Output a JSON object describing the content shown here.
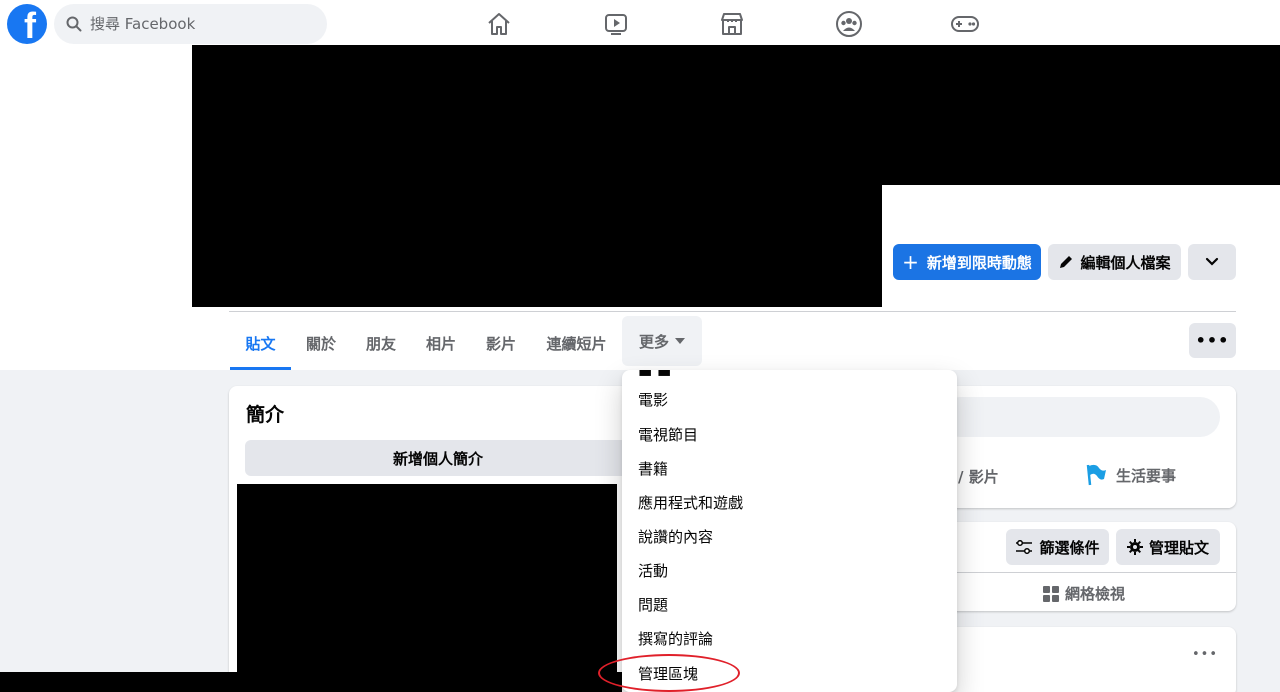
{
  "search": {
    "placeholder": "搜尋 Facebook"
  },
  "nav_icons": [
    "home-icon",
    "watch-icon",
    "marketplace-icon",
    "groups-icon",
    "gaming-icon"
  ],
  "profile": {
    "add_story_label": "新增到限時動態",
    "edit_profile_label": "編輯個人檔案"
  },
  "tabs": [
    {
      "label": "貼文",
      "active": true
    },
    {
      "label": "關於"
    },
    {
      "label": "朋友"
    },
    {
      "label": "相片"
    },
    {
      "label": "影片"
    },
    {
      "label": "連續短片"
    },
    {
      "label": "更多"
    }
  ],
  "intro": {
    "title": "簡介",
    "add_bio_label": "新增個人簡介"
  },
  "composer": {
    "photo_video_label": "/ 影片",
    "life_event_label": "生活要事"
  },
  "posts": {
    "filter_label": "篩選條件",
    "manage_label": "管理貼文",
    "grid_view_label": "網格檢視"
  },
  "dropdown": {
    "items": [
      "電影",
      "電視節目",
      "書籍",
      "應用程式和遊戲",
      "說讚的內容",
      "活動",
      "問題",
      "撰寫的評論",
      "管理區塊"
    ]
  },
  "colors": {
    "brand": "#1877f2",
    "primary_button": "#1b74e4",
    "highlight": "#e0202a"
  }
}
